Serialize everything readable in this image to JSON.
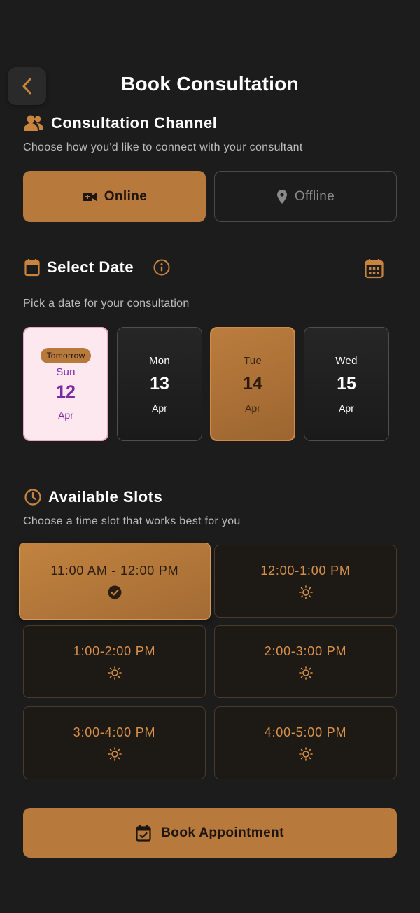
{
  "header": {
    "title": "Book Consultation"
  },
  "channel": {
    "title": "Consultation Channel",
    "subtitle": "Choose how you'd like to connect with your consultant",
    "online_label": "Online",
    "offline_label": "Offline",
    "selected": "Online"
  },
  "date": {
    "title": "Select Date",
    "subtitle": "Pick a date for your consultation",
    "cards": [
      {
        "badge": "Tomorrow",
        "dow": "Sun",
        "day": "12",
        "month": "Apr"
      },
      {
        "dow": "Mon",
        "day": "13",
        "month": "Apr"
      },
      {
        "dow": "Tue",
        "day": "14",
        "month": "Apr"
      },
      {
        "dow": "Wed",
        "day": "15",
        "month": "Apr"
      }
    ],
    "selected": "14"
  },
  "slots": {
    "title": "Available Slots",
    "subtitle": "Choose a time slot that works best for you",
    "items": [
      {
        "label": "11:00 AM - 12:00 PM"
      },
      {
        "label": "12:00-1:00 PM"
      },
      {
        "label": "1:00-2:00 PM"
      },
      {
        "label": "2:00-3:00 PM"
      },
      {
        "label": "3:00-4:00 PM"
      },
      {
        "label": "4:00-5:00 PM"
      }
    ],
    "selected": "11:00 AM - 12:00 PM"
  },
  "actions": {
    "book_label": "Book Appointment"
  },
  "icons": {
    "back": "chevron-left-icon",
    "people": "users-icon",
    "video": "video-camera-icon",
    "location": "map-pin-icon",
    "calendar": "calendar-icon",
    "info": "info-icon",
    "calendar_grid": "calendar-grid-icon",
    "clock": "clock-icon",
    "check": "check-circle-icon",
    "sun": "sun-icon",
    "calendar_check": "calendar-check-icon"
  },
  "colors": {
    "background": "#1c1c1c",
    "accent": "#b87a3c",
    "slot_text": "#d9914a",
    "today_bg": "#fde8f0",
    "today_text": "#7a2aa3"
  }
}
